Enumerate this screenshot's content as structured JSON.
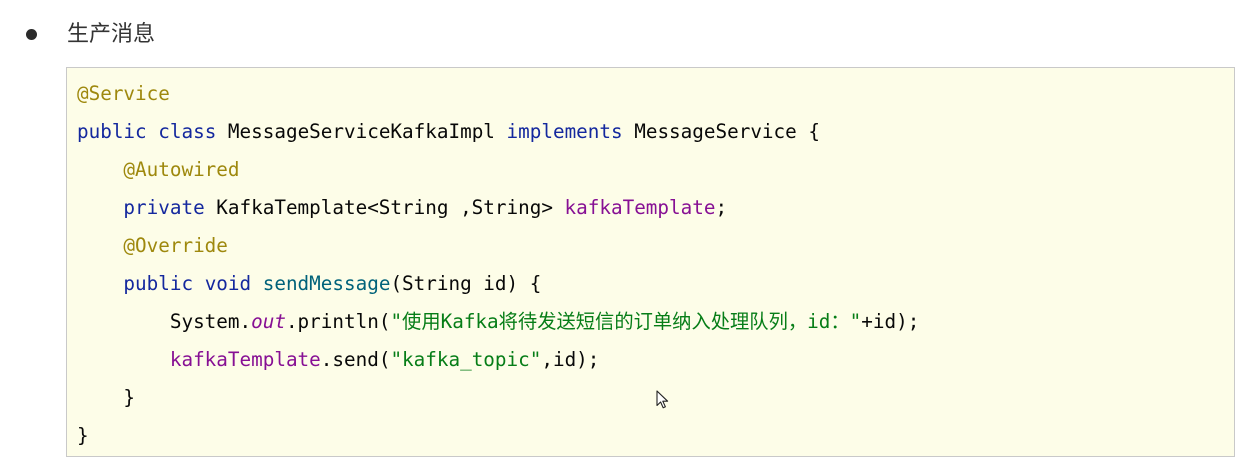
{
  "heading": {
    "text": "生产消息"
  },
  "theme": {
    "text": "#080808",
    "annotation": "#9e880d",
    "keyword": "#14289e",
    "method": "#00627a",
    "field": "#871094",
    "string": "#067d17",
    "code-bg": "#fdfde8",
    "code-border": "#c9c9c9"
  },
  "icons": {
    "bullet": "bullet-dot-icon",
    "cursor": "mouse-pointer-icon"
  },
  "code": {
    "lines": [
      [
        "@Service"
      ],
      [
        "public",
        " ",
        "class",
        " MessageServiceKafkaImpl ",
        "implements",
        " MessageService {"
      ],
      [
        "@Autowired"
      ],
      [
        "private",
        " KafkaTemplate<String ,String> ",
        "kafkaTemplate",
        ";"
      ],
      [
        "@Override"
      ],
      [
        "public",
        " ",
        "void",
        " ",
        "sendMessage",
        "(String id) {"
      ],
      [
        "System.",
        "out",
        ".println(",
        "\"使用Kafka将待发送短信的订单纳入处理队列，id：\"",
        "+id);"
      ],
      [
        "kafkaTemplate",
        ".send(",
        "\"kafka_topic\"",
        ",id);"
      ],
      [
        "}"
      ],
      [
        "}"
      ]
    ]
  }
}
